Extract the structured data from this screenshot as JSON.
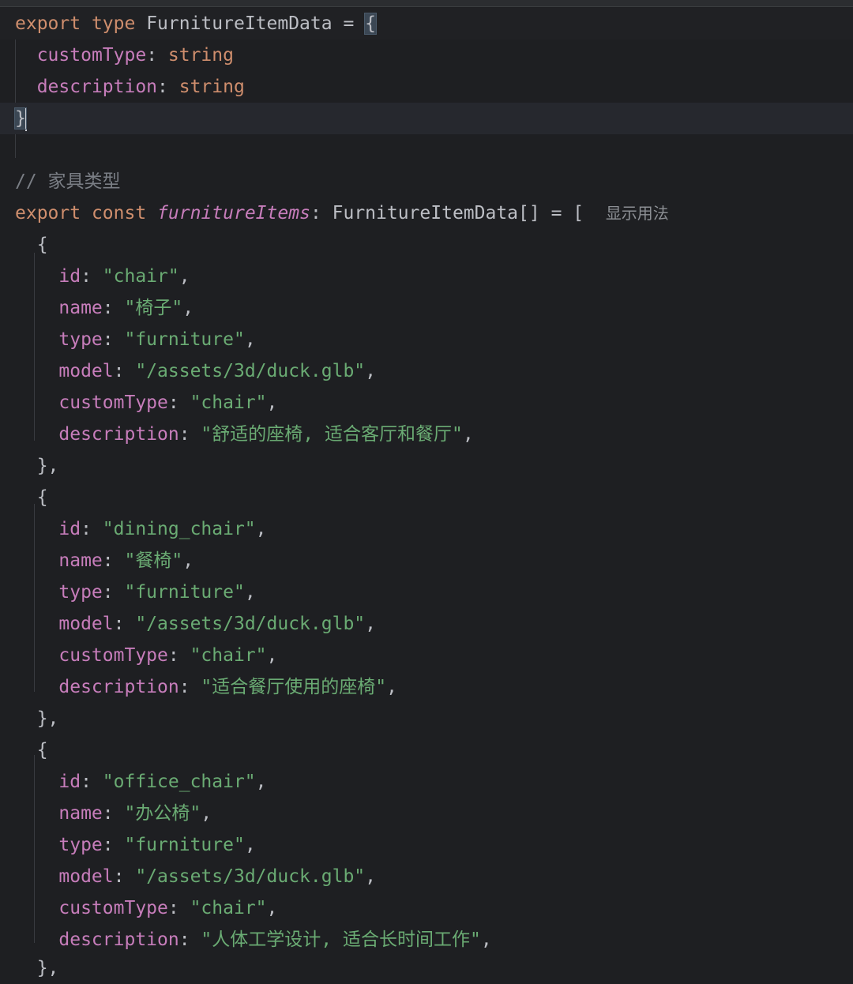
{
  "editor": {
    "lines": [
      {
        "tokens": [
          {
            "c": "kw",
            "t": "export"
          },
          {
            "c": "plain",
            "t": " "
          },
          {
            "c": "kw",
            "t": "type"
          },
          {
            "c": "plain",
            "t": " FurnitureItemData = "
          },
          {
            "c": "brace",
            "t": "{"
          }
        ]
      },
      {
        "tokens": [
          {
            "c": "plain",
            "t": "  "
          },
          {
            "c": "prop",
            "t": "customType"
          },
          {
            "c": "plain",
            "t": ": "
          },
          {
            "c": "kw",
            "t": "string"
          }
        ]
      },
      {
        "tokens": [
          {
            "c": "plain",
            "t": "  "
          },
          {
            "c": "prop",
            "t": "description"
          },
          {
            "c": "plain",
            "t": ": "
          },
          {
            "c": "kw",
            "t": "string"
          }
        ]
      },
      {
        "tokens": [
          {
            "c": "brace",
            "t": "}"
          },
          {
            "c": "caret",
            "t": ""
          }
        ]
      },
      {
        "tokens": []
      },
      {
        "tokens": [
          {
            "c": "cmt",
            "t": "// 家具类型"
          }
        ]
      },
      {
        "tokens": [
          {
            "c": "kw",
            "t": "export"
          },
          {
            "c": "plain",
            "t": " "
          },
          {
            "c": "kw",
            "t": "const"
          },
          {
            "c": "plain",
            "t": " "
          },
          {
            "c": "fn",
            "t": "furnitureItems"
          },
          {
            "c": "plain",
            "t": ": FurnitureItemData[] = [  "
          },
          {
            "c": "hint",
            "t": "显示用法"
          }
        ]
      },
      {
        "tokens": [
          {
            "c": "plain",
            "t": "  {"
          }
        ]
      },
      {
        "tokens": [
          {
            "c": "plain",
            "t": "    "
          },
          {
            "c": "prop",
            "t": "id"
          },
          {
            "c": "plain",
            "t": ": "
          },
          {
            "c": "str",
            "t": "\"chair\""
          },
          {
            "c": "plain",
            "t": ","
          }
        ]
      },
      {
        "tokens": [
          {
            "c": "plain",
            "t": "    "
          },
          {
            "c": "prop",
            "t": "name"
          },
          {
            "c": "plain",
            "t": ": "
          },
          {
            "c": "str",
            "t": "\"椅子\""
          },
          {
            "c": "plain",
            "t": ","
          }
        ]
      },
      {
        "tokens": [
          {
            "c": "plain",
            "t": "    "
          },
          {
            "c": "prop",
            "t": "type"
          },
          {
            "c": "plain",
            "t": ": "
          },
          {
            "c": "str",
            "t": "\"furniture\""
          },
          {
            "c": "plain",
            "t": ","
          }
        ]
      },
      {
        "tokens": [
          {
            "c": "plain",
            "t": "    "
          },
          {
            "c": "prop",
            "t": "model"
          },
          {
            "c": "plain",
            "t": ": "
          },
          {
            "c": "str",
            "t": "\"/assets/3d/duck.glb\""
          },
          {
            "c": "plain",
            "t": ","
          }
        ]
      },
      {
        "tokens": [
          {
            "c": "plain",
            "t": "    "
          },
          {
            "c": "prop",
            "t": "customType"
          },
          {
            "c": "plain",
            "t": ": "
          },
          {
            "c": "str",
            "t": "\"chair\""
          },
          {
            "c": "plain",
            "t": ","
          }
        ]
      },
      {
        "tokens": [
          {
            "c": "plain",
            "t": "    "
          },
          {
            "c": "prop",
            "t": "description"
          },
          {
            "c": "plain",
            "t": ": "
          },
          {
            "c": "str",
            "t": "\"舒适的座椅, 适合客厅和餐厅\""
          },
          {
            "c": "plain",
            "t": ","
          }
        ]
      },
      {
        "tokens": [
          {
            "c": "plain",
            "t": "  },"
          }
        ]
      },
      {
        "tokens": [
          {
            "c": "plain",
            "t": "  {"
          }
        ]
      },
      {
        "tokens": [
          {
            "c": "plain",
            "t": "    "
          },
          {
            "c": "prop",
            "t": "id"
          },
          {
            "c": "plain",
            "t": ": "
          },
          {
            "c": "str",
            "t": "\"dining_chair\""
          },
          {
            "c": "plain",
            "t": ","
          }
        ]
      },
      {
        "tokens": [
          {
            "c": "plain",
            "t": "    "
          },
          {
            "c": "prop",
            "t": "name"
          },
          {
            "c": "plain",
            "t": ": "
          },
          {
            "c": "str",
            "t": "\"餐椅\""
          },
          {
            "c": "plain",
            "t": ","
          }
        ]
      },
      {
        "tokens": [
          {
            "c": "plain",
            "t": "    "
          },
          {
            "c": "prop",
            "t": "type"
          },
          {
            "c": "plain",
            "t": ": "
          },
          {
            "c": "str",
            "t": "\"furniture\""
          },
          {
            "c": "plain",
            "t": ","
          }
        ]
      },
      {
        "tokens": [
          {
            "c": "plain",
            "t": "    "
          },
          {
            "c": "prop",
            "t": "model"
          },
          {
            "c": "plain",
            "t": ": "
          },
          {
            "c": "str",
            "t": "\"/assets/3d/duck.glb\""
          },
          {
            "c": "plain",
            "t": ","
          }
        ]
      },
      {
        "tokens": [
          {
            "c": "plain",
            "t": "    "
          },
          {
            "c": "prop",
            "t": "customType"
          },
          {
            "c": "plain",
            "t": ": "
          },
          {
            "c": "str",
            "t": "\"chair\""
          },
          {
            "c": "plain",
            "t": ","
          }
        ]
      },
      {
        "tokens": [
          {
            "c": "plain",
            "t": "    "
          },
          {
            "c": "prop",
            "t": "description"
          },
          {
            "c": "plain",
            "t": ": "
          },
          {
            "c": "str",
            "t": "\"适合餐厅使用的座椅\""
          },
          {
            "c": "plain",
            "t": ","
          }
        ]
      },
      {
        "tokens": [
          {
            "c": "plain",
            "t": "  },"
          }
        ]
      },
      {
        "tokens": [
          {
            "c": "plain",
            "t": "  {"
          }
        ]
      },
      {
        "tokens": [
          {
            "c": "plain",
            "t": "    "
          },
          {
            "c": "prop",
            "t": "id"
          },
          {
            "c": "plain",
            "t": ": "
          },
          {
            "c": "str",
            "t": "\"office_chair\""
          },
          {
            "c": "plain",
            "t": ","
          }
        ]
      },
      {
        "tokens": [
          {
            "c": "plain",
            "t": "    "
          },
          {
            "c": "prop",
            "t": "name"
          },
          {
            "c": "plain",
            "t": ": "
          },
          {
            "c": "str",
            "t": "\"办公椅\""
          },
          {
            "c": "plain",
            "t": ","
          }
        ]
      },
      {
        "tokens": [
          {
            "c": "plain",
            "t": "    "
          },
          {
            "c": "prop",
            "t": "type"
          },
          {
            "c": "plain",
            "t": ": "
          },
          {
            "c": "str",
            "t": "\"furniture\""
          },
          {
            "c": "plain",
            "t": ","
          }
        ]
      },
      {
        "tokens": [
          {
            "c": "plain",
            "t": "    "
          },
          {
            "c": "prop",
            "t": "model"
          },
          {
            "c": "plain",
            "t": ": "
          },
          {
            "c": "str",
            "t": "\"/assets/3d/duck.glb\""
          },
          {
            "c": "plain",
            "t": ","
          }
        ]
      },
      {
        "tokens": [
          {
            "c": "plain",
            "t": "    "
          },
          {
            "c": "prop",
            "t": "customType"
          },
          {
            "c": "plain",
            "t": ": "
          },
          {
            "c": "str",
            "t": "\"chair\""
          },
          {
            "c": "plain",
            "t": ","
          }
        ]
      },
      {
        "tokens": [
          {
            "c": "plain",
            "t": "    "
          },
          {
            "c": "prop",
            "t": "description"
          },
          {
            "c": "plain",
            "t": ": "
          },
          {
            "c": "str",
            "t": "\"人体工学设计, 适合长时间工作\""
          },
          {
            "c": "plain",
            "t": ","
          }
        ]
      },
      {
        "tokens": [
          {
            "c": "plain",
            "t": "  },"
          }
        ]
      }
    ]
  },
  "colors": {
    "background": "#1e1f22",
    "keyword": "#cf8e6d",
    "property": "#c77dbb",
    "string": "#6aab73",
    "comment": "#7a7e85",
    "text": "#bcbec4"
  }
}
